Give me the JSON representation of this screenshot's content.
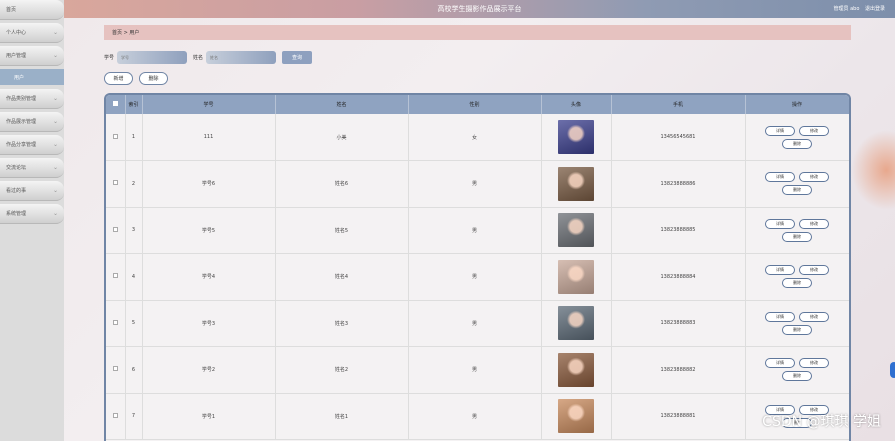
{
  "header": {
    "title": "高校学生摄影作品展示平台",
    "admin_label": "管理员 abo",
    "logout_label": "退出登录"
  },
  "sidebar": {
    "items": [
      {
        "label": "首页"
      },
      {
        "label": "个人中心"
      },
      {
        "label": "用户管理"
      },
      {
        "sub_label": "用户"
      },
      {
        "label": "作品类别管理"
      },
      {
        "label": "作品展示管理"
      },
      {
        "label": "作品分享管理"
      },
      {
        "label": "交流论坛"
      },
      {
        "label": "看过的事"
      },
      {
        "label": "系统管理"
      }
    ]
  },
  "breadcrumb": "首页 > 用户",
  "search": {
    "field1_label": "学号",
    "field1_placeholder": "学号",
    "field2_label": "姓名",
    "field2_placeholder": "姓名",
    "button_label": "查询"
  },
  "actions": {
    "add_label": "新增",
    "delete_label": "删除"
  },
  "table": {
    "columns": [
      "",
      "索引",
      "学号",
      "姓名",
      "性别",
      "头像",
      "手机",
      "操作"
    ],
    "op_labels": {
      "detail": "详情",
      "edit": "修改",
      "delete": "删除"
    },
    "rows": [
      {
        "index": "1",
        "student_no": "111",
        "name": "小美",
        "gender": "女",
        "phone": "13456545681",
        "avatar_color": "#3b3f8e"
      },
      {
        "index": "2",
        "student_no": "学号6",
        "name": "姓名6",
        "gender": "男",
        "phone": "13823888886",
        "avatar_color": "#7a5c44"
      },
      {
        "index": "3",
        "student_no": "学号5",
        "name": "姓名5",
        "gender": "男",
        "phone": "13823888885",
        "avatar_color": "#6b6f75"
      },
      {
        "index": "4",
        "student_no": "学号4",
        "name": "姓名4",
        "gender": "男",
        "phone": "13823888884",
        "avatar_color": "#c9a99a"
      },
      {
        "index": "5",
        "student_no": "学号3",
        "name": "姓名3",
        "gender": "男",
        "phone": "13823888883",
        "avatar_color": "#5d6b78"
      },
      {
        "index": "6",
        "student_no": "学号2",
        "name": "姓名2",
        "gender": "男",
        "phone": "13823888882",
        "avatar_color": "#8a5a3c"
      },
      {
        "index": "7",
        "student_no": "学号1",
        "name": "姓名1",
        "gender": "男",
        "phone": "13823888881",
        "avatar_color": "#c98b5e"
      }
    ]
  },
  "watermark": "CSDN @琪琪 学姐"
}
